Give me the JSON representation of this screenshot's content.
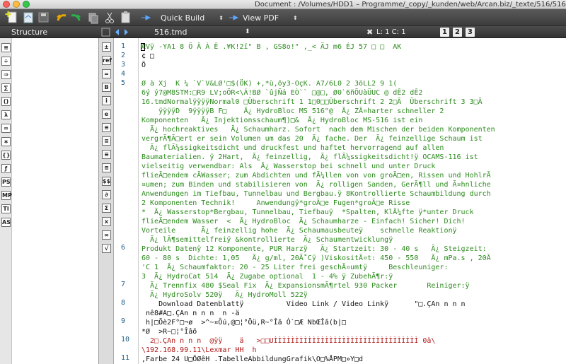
{
  "window": {
    "title": "Document : /Volumes/HDD1 – Programme/_copy/_kunden/web/Arcan.biz/_texte/516/516.tmd",
    "traffic_lights": {
      "close": "#fc605c",
      "minimize": "#fdbc40",
      "zoom": "#34c84a"
    }
  },
  "toolbar": {
    "icons": [
      "new-document-icon",
      "open-document-icon",
      "save-icon",
      "undo-icon",
      "redo-icon",
      "copy-icon",
      "cut-icon",
      "paste-icon"
    ],
    "quick_build_label": "Quick Build",
    "view_pdf_label": "View PDF"
  },
  "tabbar": {
    "structure_label": "Structure",
    "file_tab": "516.tmd",
    "position": "L: 1 C: 1",
    "view_buttons": [
      "1",
      "2",
      "3"
    ]
  },
  "structure_icons": [
    "≡",
    "÷",
    "⇒",
    "∑",
    "()",
    "λ",
    "∞",
    "∗",
    "{}",
    "ƒ",
    "PS",
    "MP",
    "Tl",
    "AS"
  ],
  "palette_icons": [
    "±",
    "ref",
    "=",
    "B",
    "i",
    "e",
    "≡",
    "≡",
    "≡",
    "≡",
    "$$",
    "∂",
    "Σ",
    "x",
    "∞",
    "√"
  ],
  "line_numbers": [
    "1",
    "2",
    "3",
    "4",
    "5",
    "6",
    "7",
    "8",
    "9",
    "10",
    "11"
  ],
  "editor_lines": [
    "ÆVÿ -YA1 8 Ö Â À Ê .¥K!2ï\" B , GS8o!\" ,_< ÄJ m6 ÉJ 57 □ □  AK",
    "¢ □",
    "Ö",
    "",
    "Ø à Xj  K ¼ `V`V&LØ'□$(ÖK) +,*ù,õy3-OçK. A7/6L0 2 3öLL2 9 1(",
    "6ý ý7@M8STM:□R9 LV;oÖR<\\Á!BØ `ûjÑá EÒ`` □@□, Ø0`6ñÕUàÜUC @ dÊ2 dÊ2",
    "16.tmdNormalÿÿÿÿNormal0 □Überschrift 1 1□0□□Überschrift 2 2□Ã  Überschrift 3 3□Ã",
    "    ÿÿÿÿD  9ÿÿÿÿB F□    Ã¿ HydroBloc MS 516\"@  Ã¿ ZÃ¤harter schneller 2",
    "Komponenten   Ã¿ Injektionsschaum¶)□&  Ã¿ HydroBloc MS-516 ist ein",
    "  Ã¿ hochreaktives   Ã¿ Schaumharz. Sofort  nach dem Mischen der beiden Komponenten",
    "vergrÃ¶Ã□ert er sein Volumen um das 20  Ã¿ fache. Der  Ã¿ feinzellige Schaum ist",
    "  Ã¿ flÃ¼ssigkeitsdicht und druckfest und haftet hervorragend auf allen",
    "Baumaterialien. ÿ 2Hart,  Ã¿ feinzellig,  Ã¿ flÃ¼ssigkeitsdicht!ÿ OCAMS-116 ist",
    "vielseitig verwendbar: Als  Ã¿ Wasserstop bei schnell und unter Druck",
    "flieÃ□endem cÃWasser; zum Abdichten und fÃ¼llen von von groÃ□en, Rissen und HohlrÃ",
    "¤umen; zum Binden und stabilisieren von  Ã¿ rolligen Sanden, GerÃ¶ll und Ã¤hnliche",
    "Anwendungen im Tiefbau, Tunnelbau und Bergbau.ÿ 8Kontrollierte Schaumbildung durch",
    "2 Komponenten Technik!     Anwendungÿ*groÃ□e Fugen*groÃ□e Risse",
    "*  Ã¿ Wasserstop*Bergbau, Tunnelbau, Tiefbauÿ  *Spalten, KlÃ¼fte ÿ*unter Druck",
    "flieÃ□endem Wasser  <  Ã¿ HydroBloc  Ã¿ Schaumharze - Einfach! Sicher! Dich!",
    "Vorteile      Ã¿ feinzellig hohe  Ã¿ Schaumausbeuteÿ    schnelle Reaktionÿ",
    "  Ã¿ lÃ¶semittelfreiÿ &kontrollierte  Ã¿ Schaumentwicklungÿ",
    "Produkt Datenÿ 12 Komponente, PUR Harzÿ   Ã¿ Startzeit: 30 - 40 s   Ã¿ Steigzeit:",
    "60 - 80 s  Dichte: 1,05   Ã¿ g/ml, 20Ã˚Cÿ )ViskositÃ¤t: 450 - 550   Ã¿ mPa.s , 20Ã",
    "'C 1  Ã¿ Schaumfaktor: 20 - 25 Liter frei geschÃ¤umtÿ     Beschleuniger:",
    "3  Ã¿ HydroCat 514  Ã¿ Zugabe optional  1 - 4% ÿ ZubehÃ¶r:ÿ",
    "  Ã¿ Trennfix 480 $Seal Fix  Ã¿ ExpansionsmÃ¶rtel 930 Packer       Reiniger:ÿ",
    "  Ã¿ HydroSolv 520ÿ   Ã¿ HydroMoll 522ÿ",
    "    Download Datenblattÿ          Video Link / Video Linkÿ      \"□.ÇAn n n n",
    " nê8#A□.ÇAn n n n  n -ä",
    " h|□Õè2F°□¬ø  >^~¤Ôú,@□¦°Õü,R~°Îâ Ò`□Æ NbŒÎâ(b|□",
    "*Ø  >R~□¦°Îâõ",
    "  2□.ÇAn n n n  @ÿÿ    ä   >□□UÌÌÌÌÌÌÌÌÌÌÌÌÌÌÌÌÌÌÌÌÌÌÌÌÌÌÌÌÌÌÌÌÌÌ 0ä\\",
    "\\192.168.99.11\\Lexmar HH  h",
    ",Farbe 24 U□ÕØêH .TabelleAbbildungGrafik\\O□%ÅPM□»Y□d"
  ]
}
